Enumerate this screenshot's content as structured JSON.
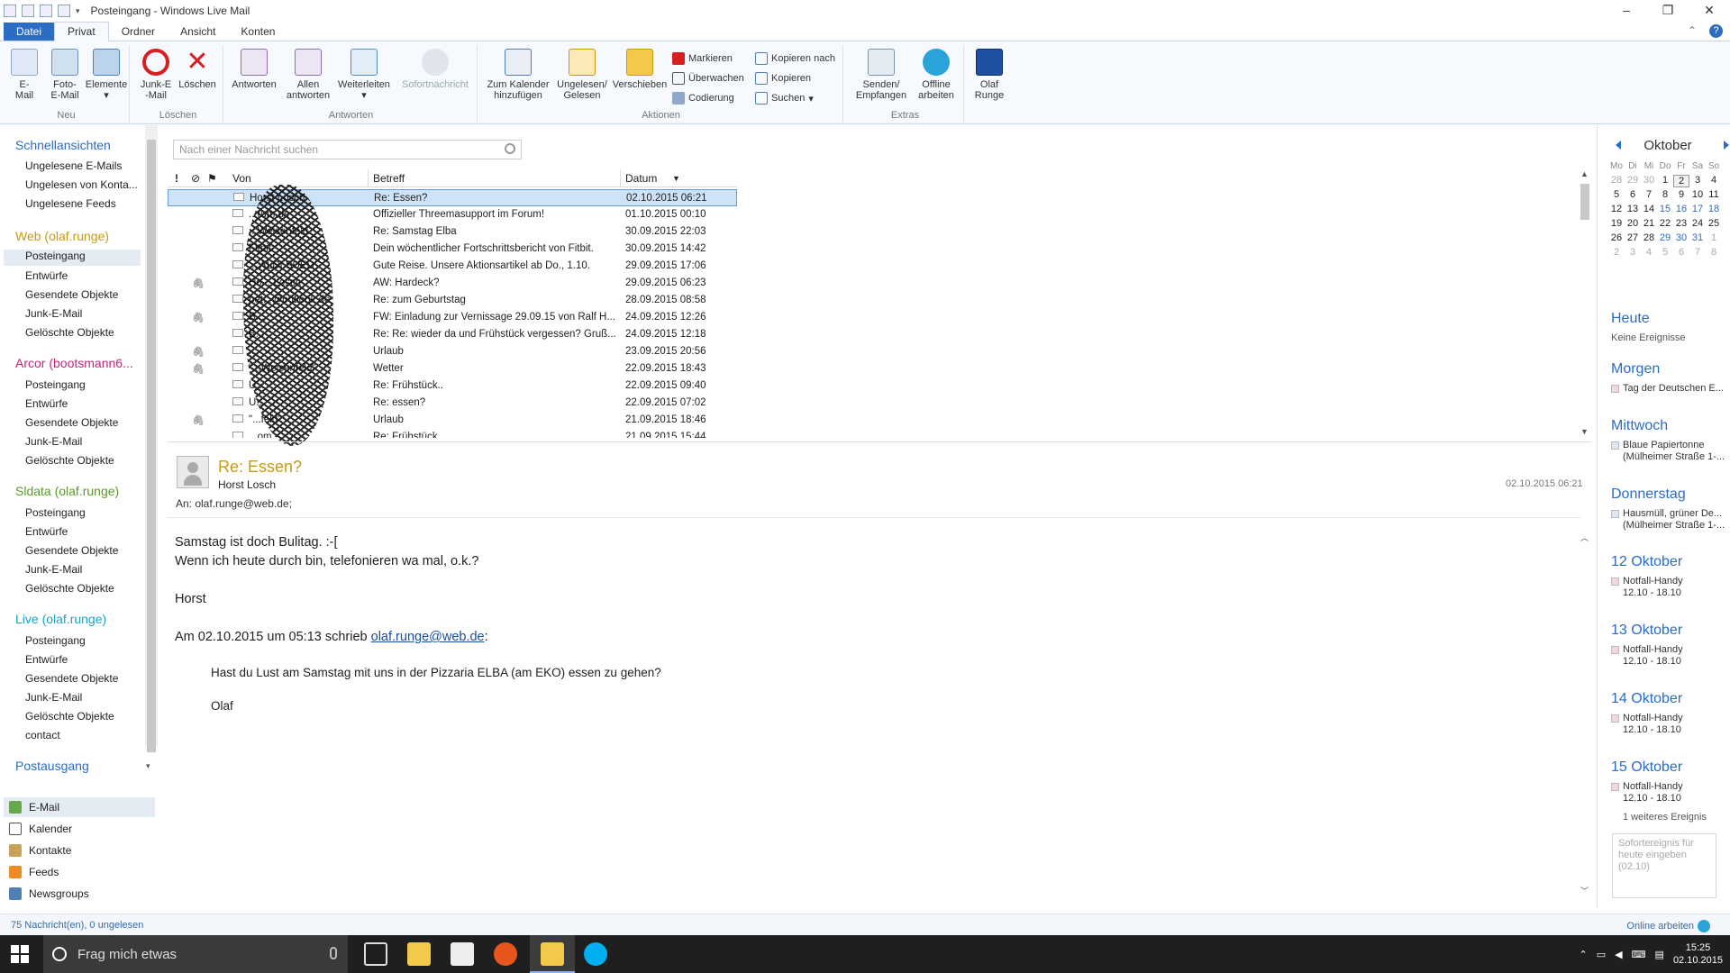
{
  "window": {
    "title": "Posteingang - Windows Live Mail",
    "minimize": "–",
    "maximize": "❐",
    "close": "✕"
  },
  "ribbon_tabs": [
    "Datei",
    "Privat",
    "Ordner",
    "Ansicht",
    "Konten"
  ],
  "ribbon": {
    "groups": {
      "neu": "Neu",
      "loeschen": "Löschen",
      "antworten": "Antworten",
      "aktionen": "Aktionen",
      "extras": "Extras"
    },
    "email": "E-\nMail",
    "foto_email": "Foto-\nE-Mail",
    "elemente": "Elemente",
    "junk": "Junk-E\n-Mail",
    "loeschen": "Löschen",
    "antworten": "Antworten",
    "allen_antworten": "Allen\nantworten",
    "weiterleiten": "Weiterleiten",
    "sofortnachricht": "Sofortnachricht",
    "kalender": "Zum Kalender\nhinzufügen",
    "ungelesen": "Ungelesen/\nGelesen",
    "verschieben": "Verschieben",
    "markieren": "Markieren",
    "ueberwachen": "Überwachen",
    "codierung": "Codierung",
    "kopieren_nach": "Kopieren nach",
    "kopieren": "Kopieren",
    "suchen": "Suchen",
    "senden": "Senden/\nEmpfangen",
    "offline": "Offline\narbeiten",
    "olaf": "Olaf\nRunge"
  },
  "nav": {
    "schnellansichten": {
      "title": "Schnellansichten",
      "items": [
        "Ungelesene E-Mails",
        "Ungelesen von Konta...",
        "Ungelesene Feeds"
      ]
    },
    "accounts": [
      {
        "name": "Web (olaf.runge)",
        "color": "#c79a10",
        "folders": [
          "Posteingang",
          "Entwürfe",
          "Gesendete Objekte",
          "Junk-E-Mail",
          "Gelöschte Objekte"
        ]
      },
      {
        "name": "Arcor (bootsmann6...",
        "color": "#c0267a",
        "folders": [
          "Posteingang",
          "Entwürfe",
          "Gesendete Objekte",
          "Junk-E-Mail",
          "Gelöschte Objekte"
        ]
      },
      {
        "name": "Sldata (olaf.runge)",
        "color": "#5a9a2a",
        "folders": [
          "Posteingang",
          "Entwürfe",
          "Gesendete Objekte",
          "Junk-E-Mail",
          "Gelöschte Objekte"
        ]
      },
      {
        "name": "Live (olaf.runge)",
        "color": "#1ca3c7",
        "folders": [
          "Posteingang",
          "Entwürfe",
          "Gesendete Objekte",
          "Junk-E-Mail",
          "Gelöschte Objekte",
          "contact"
        ]
      }
    ],
    "postausgang": "Postausgang",
    "bottom": [
      "E-Mail",
      "Kalender",
      "Kontakte",
      "Feeds",
      "Newsgroups"
    ]
  },
  "search": {
    "placeholder": "Nach einer Nachricht suchen"
  },
  "list": {
    "headers": {
      "important": "!",
      "attach": "⊘",
      "flag": "⚑",
      "from": "Von",
      "subject": "Betreff",
      "date": "Datum"
    },
    "rows": [
      {
        "from": "Horst Losch",
        "subject": "Re: Essen?",
        "date": "02.10.2015 06:21",
        "attach": false
      },
      {
        "from": "...rum.de",
        "subject": "Offizieller Threemasupport im Forum!",
        "date": "01.10.2015 00:10",
        "attach": false
      },
      {
        "from": "...Weisenfeld",
        "subject": "Re: Samstag Elba",
        "date": "30.09.2015 22:03",
        "attach": false
      },
      {
        "from": "Fitbit",
        "subject": "Dein wöchentlicher Fortschrittsbericht von Fitbit.",
        "date": "30.09.2015 14:42",
        "attach": false
      },
      {
        "from": "... ALDI SUED",
        "subject": "Gute Reise. Unsere Aktionsartikel ab Do., 1.10.",
        "date": "29.09.2015 17:06",
        "attach": false
      },
      {
        "from": "Ho... Losch",
        "subject": "AW: Hardeck?",
        "date": "29.09.2015 06:23",
        "attach": true
      },
      {
        "from": "pet...@outlook.de",
        "subject": "Re: zum Geburtstag",
        "date": "28.09.2015 08:58",
        "attach": false
      },
      {
        "from": "B...",
        "subject": "FW: Einladung zur Vernissage 29.09.15 von Ralf H...",
        "date": "24.09.2015 12:26",
        "attach": true
      },
      {
        "from": "B...",
        "subject": "Re: Re: wieder da und Frühstück vergessen? Gruß...",
        "date": "24.09.2015 12:18",
        "attach": false
      },
      {
        "from": "...",
        "subject": "Urlaub",
        "date": "23.09.2015 20:56",
        "attach": true
      },
      {
        "from": "\"...Weisenfeld\"",
        "subject": "Wetter",
        "date": "22.09.2015 18:43",
        "attach": true
      },
      {
        "from": "U...",
        "subject": "Re: Frühstück..",
        "date": "22.09.2015 09:40",
        "attach": false
      },
      {
        "from": "U...",
        "subject": "Re: essen?",
        "date": "22.09.2015 07:02",
        "attach": false
      },
      {
        "from": "\"...feld\"",
        "subject": "Urlaub",
        "date": "21.09.2015 18:46",
        "attach": true
      },
      {
        "from": "...om",
        "subject": "Re: Frühstück",
        "date": "21.09.2015 15:44",
        "attach": false
      }
    ]
  },
  "reading": {
    "subject": "Re: Essen?",
    "sender": "Horst Losch",
    "to": "An: olaf.runge@web.de;",
    "date": "02.10.2015 06:21",
    "line1": "Samstag ist doch Bulitag. :-[",
    "line2": "Wenn ich heute durch bin, telefonieren wa mal, o.k.?",
    "signature": "Horst",
    "quote_intro": "Am 02.10.2015 um 05:13 schrieb ",
    "quote_link": "olaf.runge@web.de",
    "quote_colon": ":",
    "quote_text": "Hast du Lust am Samstag mit uns in der Pizzaria ELBA (am EKO) essen zu gehen?",
    "quote_sig": "Olaf"
  },
  "calendar": {
    "month": "Oktober",
    "dow": [
      "Mo",
      "Di",
      "Mi",
      "Do",
      "Fr",
      "Sa",
      "So"
    ],
    "weeks": [
      [
        "28",
        "29",
        "30",
        "1",
        "2",
        "3",
        "4"
      ],
      [
        "5",
        "6",
        "7",
        "8",
        "9",
        "10",
        "11"
      ],
      [
        "12",
        "13",
        "14",
        "15",
        "16",
        "17",
        "18"
      ],
      [
        "19",
        "20",
        "21",
        "22",
        "23",
        "24",
        "25"
      ],
      [
        "26",
        "27",
        "28",
        "29",
        "30",
        "31",
        "1"
      ],
      [
        "2",
        "3",
        "4",
        "5",
        "6",
        "7",
        "8"
      ]
    ],
    "sections": [
      {
        "head": "Heute",
        "events": [],
        "note": "Keine Ereignisse"
      },
      {
        "head": "Morgen",
        "events": [
          {
            "text": "Tag der Deutschen E...",
            "sub": ""
          }
        ]
      },
      {
        "head": "Mittwoch",
        "events": [
          {
            "text": "Blaue Papiertonne",
            "sub": "(Mülheimer Straße 1-..."
          }
        ]
      },
      {
        "head": "Donnerstag",
        "events": [
          {
            "text": "Hausmüll, grüner De...",
            "sub": "(Mülheimer Straße 1-..."
          }
        ]
      },
      {
        "head": "12 Oktober",
        "events": [
          {
            "text": "Notfall-Handy",
            "sub": "12.10 - 18.10"
          }
        ]
      },
      {
        "head": "13 Oktober",
        "events": [
          {
            "text": "Notfall-Handy",
            "sub": "12.10 - 18.10"
          }
        ]
      },
      {
        "head": "14 Oktober",
        "events": [
          {
            "text": "Notfall-Handy",
            "sub": "12.10 - 18.10"
          }
        ]
      },
      {
        "head": "15 Oktober",
        "events": [
          {
            "text": "Notfall-Handy",
            "sub": "12.10 - 18.10"
          }
        ],
        "note": "1 weiteres Ereignis"
      }
    ],
    "quick_event": "Sofortereignis für heute eingeben (02.10)"
  },
  "status": {
    "left": "75 Nachricht(en), 0 ungelesen",
    "right": "Online arbeiten"
  },
  "taskbar": {
    "search": "Frag mich etwas",
    "time": "15:25",
    "date": "02.10.2015"
  }
}
